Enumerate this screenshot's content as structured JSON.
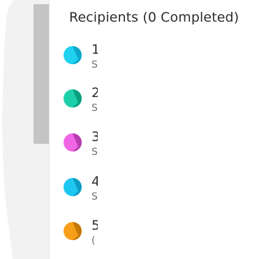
{
  "panel": {
    "title": "Recipients (0 Completed)"
  },
  "recipients": [
    {
      "number": "1",
      "sub": "S",
      "color_light": "#1fd0f0",
      "color_dark": "#0ba6c8"
    },
    {
      "number": "2",
      "sub": "S",
      "color_light": "#1ccfa8",
      "color_dark": "#0a9f7e"
    },
    {
      "number": "3",
      "sub": "S",
      "color_light": "#f166e5",
      "color_dark": "#b73cae"
    },
    {
      "number": "4",
      "sub": "S",
      "color_light": "#1ec7f2",
      "color_dark": "#0d9cc4"
    },
    {
      "number": "5",
      "sub": "(",
      "color_light": "#f79f1a",
      "color_dark": "#c57808"
    }
  ],
  "colors": {
    "document_bg": "#f2f2f2",
    "scrollbar": "#c4c4c4",
    "panel_bg": "#ffffff",
    "text_primary": "#2c2c2c",
    "text_secondary": "#707070"
  }
}
